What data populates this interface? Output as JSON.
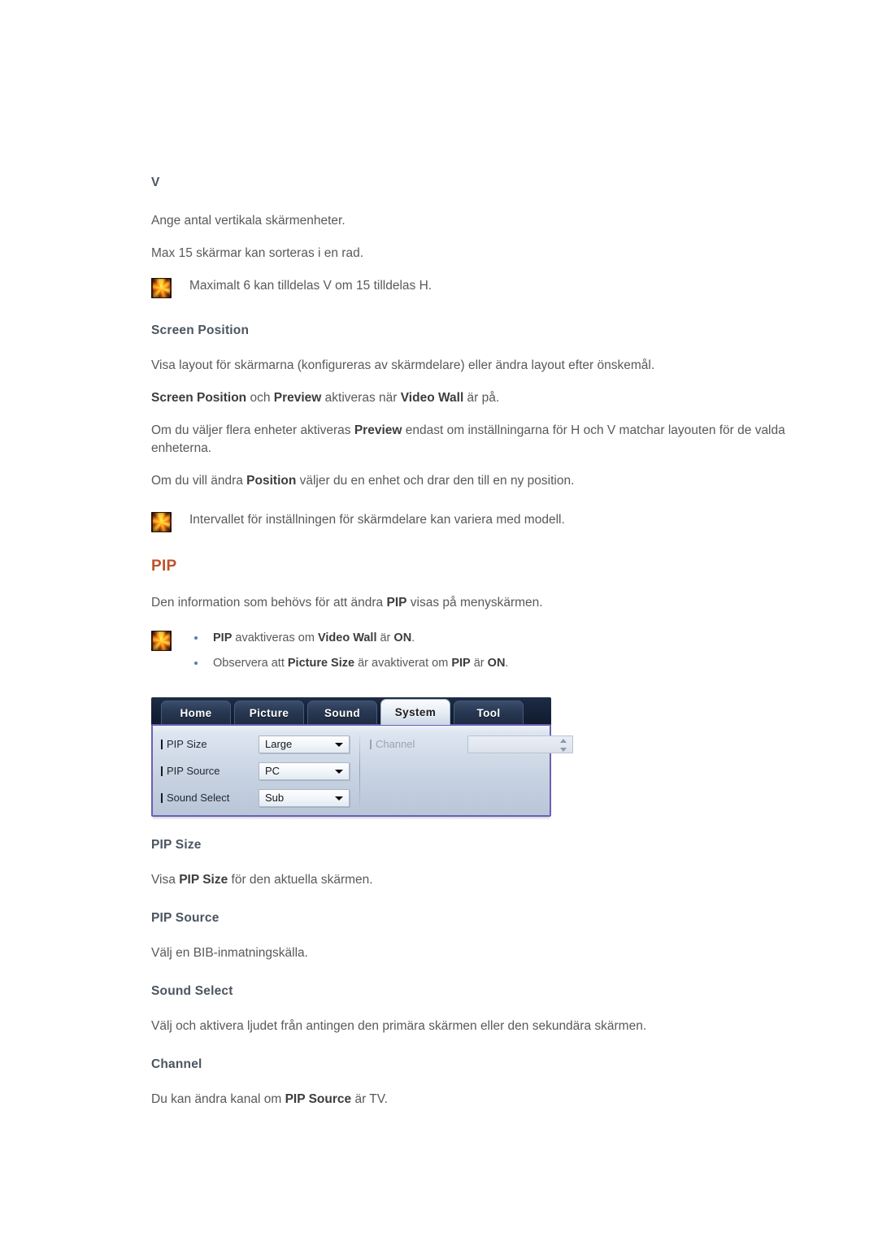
{
  "document": {
    "sections": [
      {
        "heading": "V",
        "heading_style": "sub",
        "paragraphs": [
          "Ange antal vertikala skärmenheter.",
          "Max 15 skärmar kan sorteras i en rad."
        ],
        "note": "Maximalt 6 kan tilldelas V om 15 tilldelas H."
      }
    ],
    "screen_position": {
      "heading": "Screen Position",
      "p1": "Visa layout för skärmarna (konfigureras av skärmdelare) eller ändra layout efter önskemål.",
      "p2_parts": [
        {
          "t": "Screen Position",
          "b": true
        },
        {
          "t": " och ",
          "b": false
        },
        {
          "t": "Preview",
          "b": true
        },
        {
          "t": " aktiveras när ",
          "b": false
        },
        {
          "t": "Video Wall",
          "b": true
        },
        {
          "t": " är på.",
          "b": false
        }
      ],
      "p3_parts": [
        {
          "t": "Om du väljer flera enheter aktiveras ",
          "b": false
        },
        {
          "t": "Preview",
          "b": true
        },
        {
          "t": " endast om inställningarna för H och V matchar layouten för de valda enheterna.",
          "b": false
        }
      ],
      "p4_parts": [
        {
          "t": "Om du vill ändra ",
          "b": false
        },
        {
          "t": "Position",
          "b": true
        },
        {
          "t": " väljer du en enhet och drar den till en ny position.",
          "b": false
        }
      ],
      "note": "Intervallet för inställningen för skärmdelare kan variera med modell."
    },
    "pip": {
      "heading": "PIP",
      "intro_parts": [
        {
          "t": "Den information som behövs för att ändra ",
          "b": false
        },
        {
          "t": "PIP",
          "b": true
        },
        {
          "t": " visas på menyskärmen.",
          "b": false
        }
      ],
      "bullets": [
        [
          {
            "t": "PIP",
            "b": true
          },
          {
            "t": " avaktiveras om ",
            "b": false
          },
          {
            "t": "Video Wall",
            "b": true
          },
          {
            "t": " är ",
            "b": false
          },
          {
            "t": "ON",
            "b": true
          },
          {
            "t": ".",
            "b": false
          }
        ],
        [
          {
            "t": "Observera att ",
            "b": false
          },
          {
            "t": "Picture Size",
            "b": true
          },
          {
            "t": " är avaktiverat om ",
            "b": false
          },
          {
            "t": "PIP",
            "b": true
          },
          {
            "t": " är ",
            "b": false
          },
          {
            "t": "ON",
            "b": true
          },
          {
            "t": ".",
            "b": false
          }
        ]
      ]
    },
    "definitions": [
      {
        "heading": "PIP Size",
        "body_parts": [
          {
            "t": "Visa ",
            "b": false
          },
          {
            "t": "PIP Size",
            "b": true
          },
          {
            "t": " för den aktuella skärmen.",
            "b": false
          }
        ]
      },
      {
        "heading": "PIP Source",
        "body_parts": [
          {
            "t": "Välj en BIB-inmatningskälla.",
            "b": false
          }
        ]
      },
      {
        "heading": "Sound Select",
        "body_parts": [
          {
            "t": "Välj och aktivera ljudet från antingen den primära skärmen eller den sekundära skärmen.",
            "b": false
          }
        ]
      },
      {
        "heading": "Channel",
        "body_parts": [
          {
            "t": "Du kan ändra kanal om ",
            "b": false
          },
          {
            "t": "PIP Source",
            "b": true
          },
          {
            "t": " är ",
            "b": false
          },
          {
            "t": "TV",
            "b": false
          },
          {
            "t": ".",
            "b": false
          }
        ]
      }
    ]
  },
  "mdc_screenshot": {
    "tabs": [
      {
        "label": "Home",
        "active": false
      },
      {
        "label": "Picture",
        "active": false
      },
      {
        "label": "Sound",
        "active": false
      },
      {
        "label": "System",
        "active": true
      },
      {
        "label": "Tool",
        "active": false
      }
    ],
    "fields": [
      {
        "label": "PIP Size",
        "value": "Large",
        "type": "combo",
        "disabled": false
      },
      {
        "label": "PIP Source",
        "value": "PC",
        "type": "combo",
        "disabled": false
      },
      {
        "label": "Sound Select",
        "value": "Sub",
        "type": "combo",
        "disabled": false
      }
    ],
    "right_field": {
      "label": "Channel",
      "value": "",
      "type": "spinner",
      "disabled": true
    },
    "colors": {
      "panel_border": "#6d5fb5",
      "tabbar_bg": "#16233a",
      "active_tab_bg": "#e8eef5"
    }
  },
  "theme": {
    "heading_orange": "#c0512b",
    "heading_grey": "#4b5560",
    "body_grey": "#58595b",
    "bullet_blue": "#4d7ec0"
  }
}
